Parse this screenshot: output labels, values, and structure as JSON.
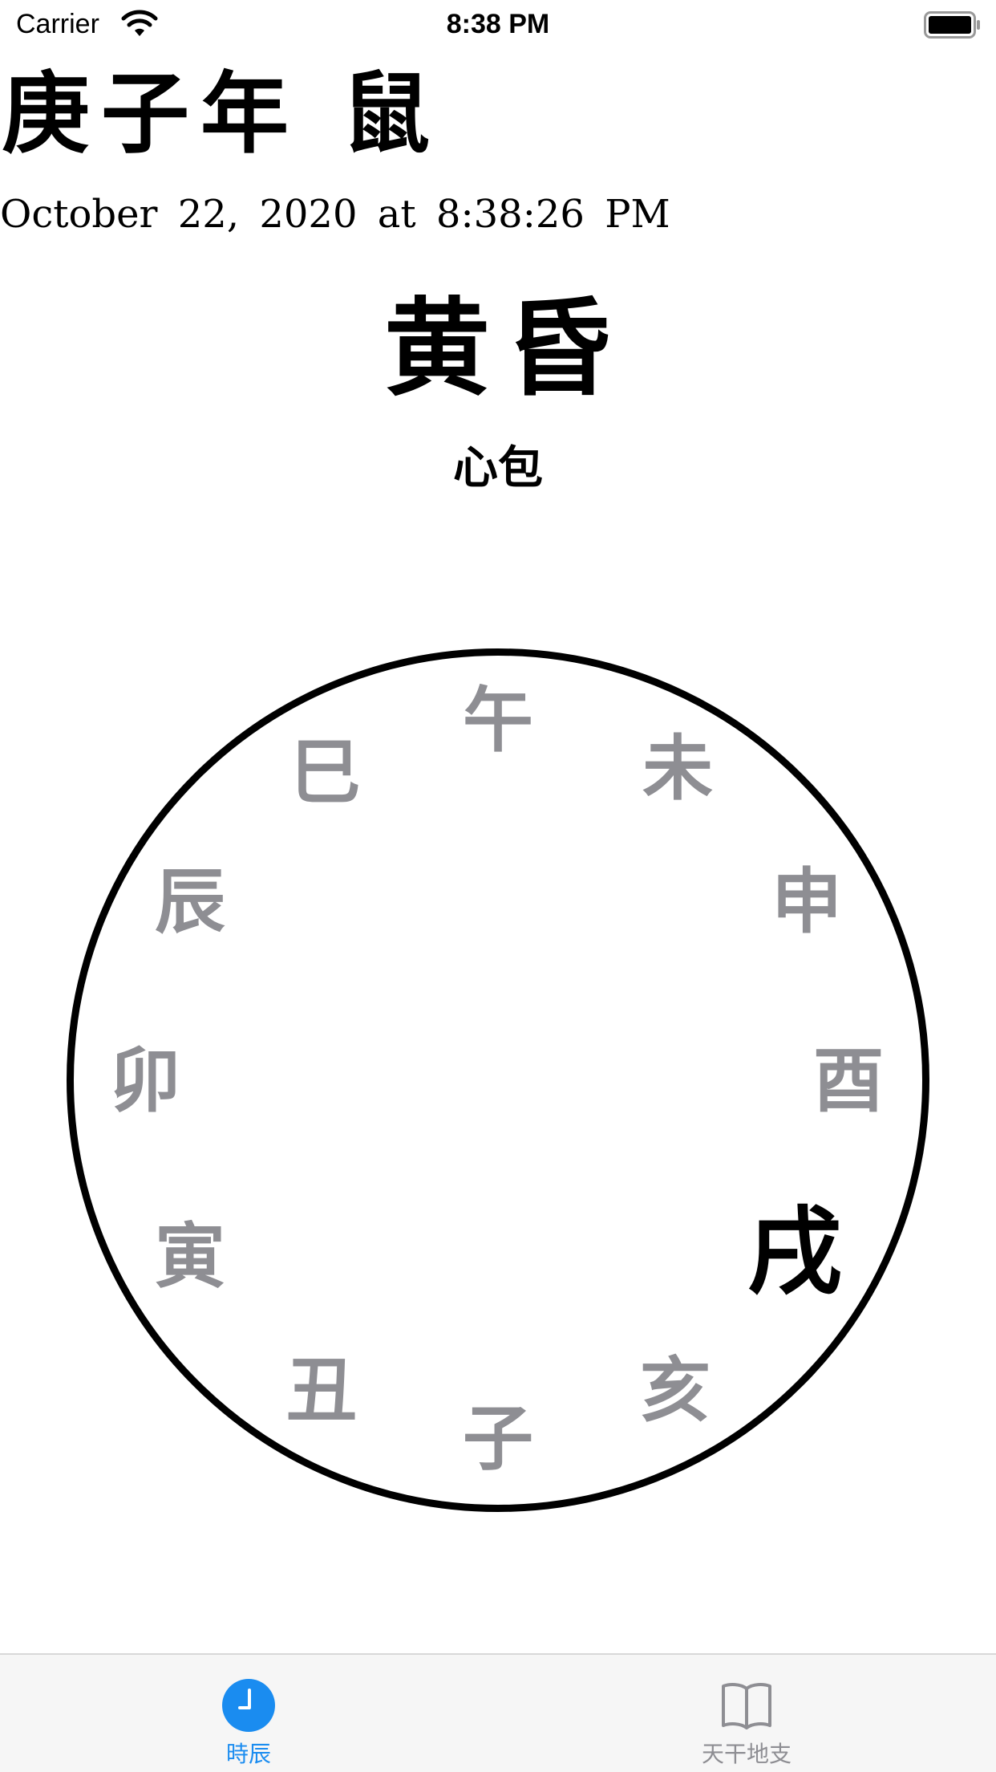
{
  "status_bar": {
    "carrier": "Carrier",
    "time": "8:38 PM",
    "icons": [
      "wifi-icon",
      "battery-icon"
    ]
  },
  "header": {
    "year_title": "庚子年 鼠",
    "datetime": "October 22, 2020 at 8:38:26 PM"
  },
  "current_period": {
    "name": "黄昏",
    "meridian": "心包"
  },
  "dial": {
    "branches": [
      {
        "label": "午",
        "active": false
      },
      {
        "label": "未",
        "active": false
      },
      {
        "label": "申",
        "active": false
      },
      {
        "label": "酉",
        "active": false
      },
      {
        "label": "戌",
        "active": true
      },
      {
        "label": "亥",
        "active": false
      },
      {
        "label": "子",
        "active": false
      },
      {
        "label": "丑",
        "active": false
      },
      {
        "label": "寅",
        "active": false
      },
      {
        "label": "卯",
        "active": false
      },
      {
        "label": "辰",
        "active": false
      },
      {
        "label": "巳",
        "active": false
      }
    ],
    "active_color": "#000000",
    "inactive_color": "#8e8e93"
  },
  "tab_bar": {
    "tabs": [
      {
        "label": "時辰",
        "icon": "clock-icon",
        "selected": true
      },
      {
        "label": "天干地支",
        "icon": "book-icon",
        "selected": false
      }
    ],
    "selected_color": "#1a8cf0",
    "unselected_color": "#8e8e93"
  }
}
